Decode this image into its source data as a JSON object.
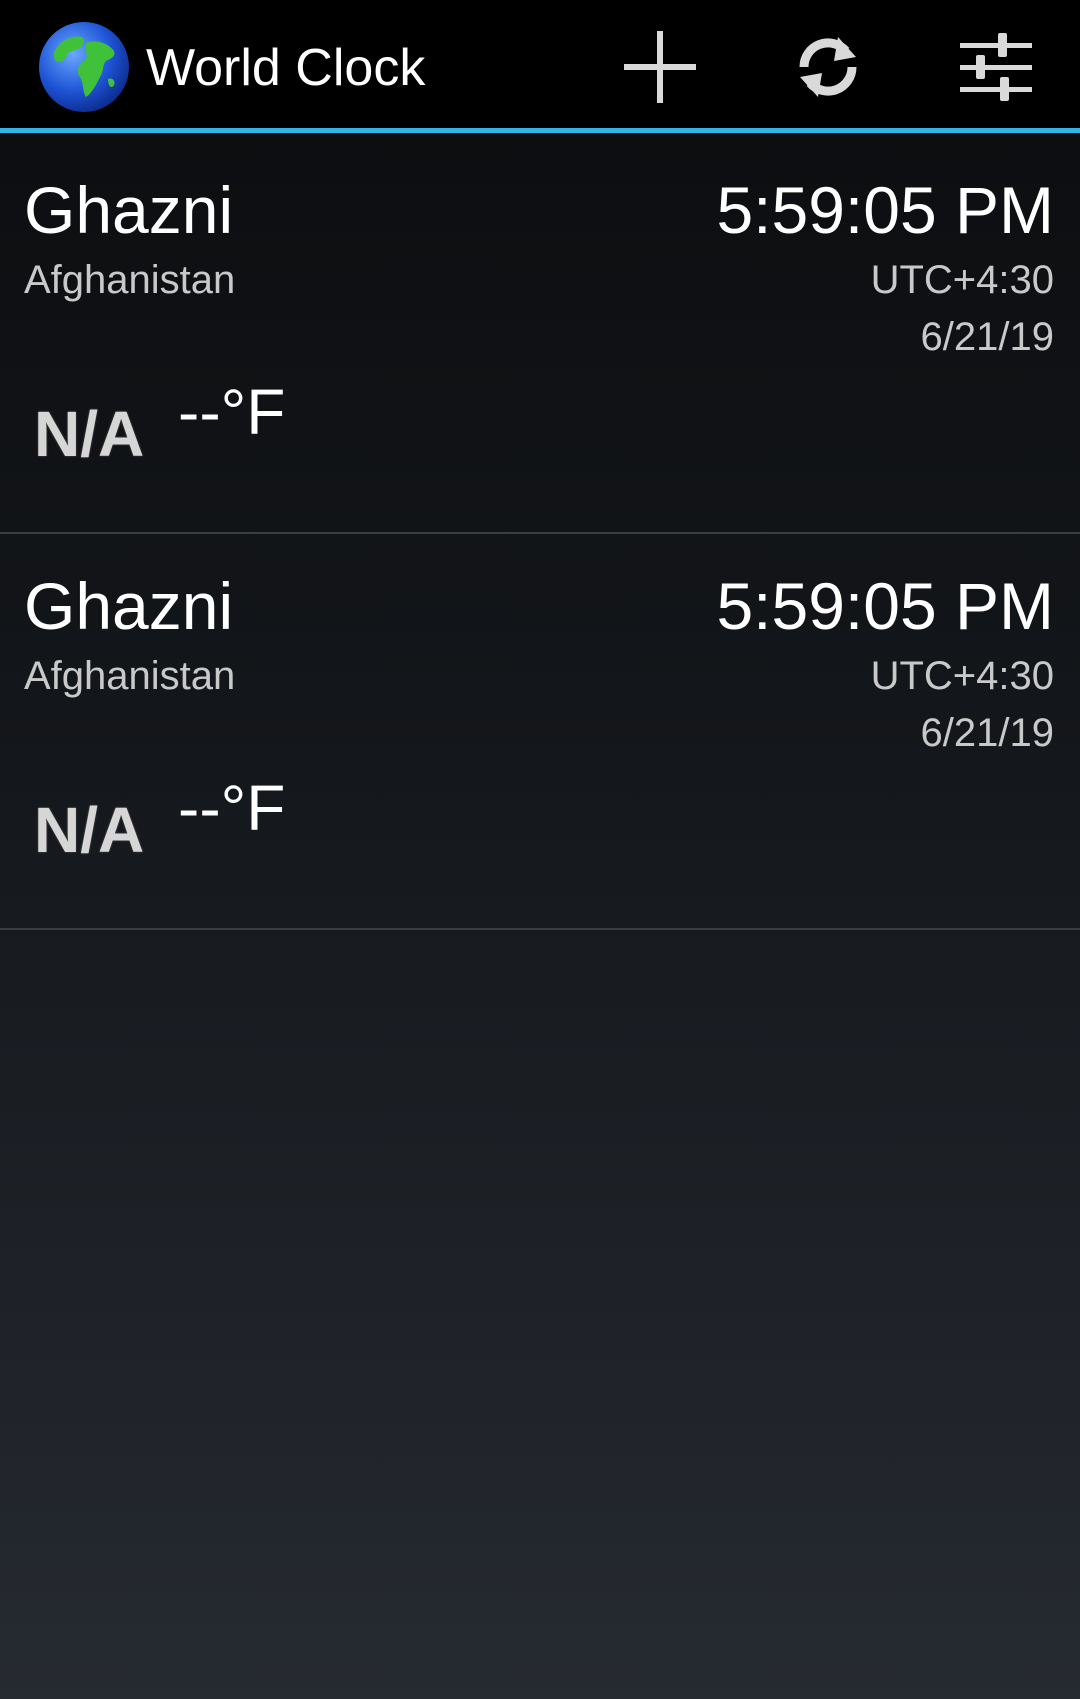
{
  "app": {
    "title": "World Clock",
    "accent_color": "#33b5e5",
    "icon": "globe-icon"
  },
  "actions": [
    {
      "name": "add",
      "icon": "plus-icon"
    },
    {
      "name": "refresh",
      "icon": "refresh-icon"
    },
    {
      "name": "settings",
      "icon": "sliders-icon"
    }
  ],
  "clocks": [
    {
      "city": "Ghazni",
      "country": "Afghanistan",
      "time": "5:59:05 PM",
      "utc_offset": "UTC+4:30",
      "date": "6/21/19",
      "weather": "N/A",
      "temperature": "--°F"
    },
    {
      "city": "Ghazni",
      "country": "Afghanistan",
      "time": "5:59:05 PM",
      "utc_offset": "UTC+4:30",
      "date": "6/21/19",
      "weather": "N/A",
      "temperature": "--°F"
    }
  ]
}
